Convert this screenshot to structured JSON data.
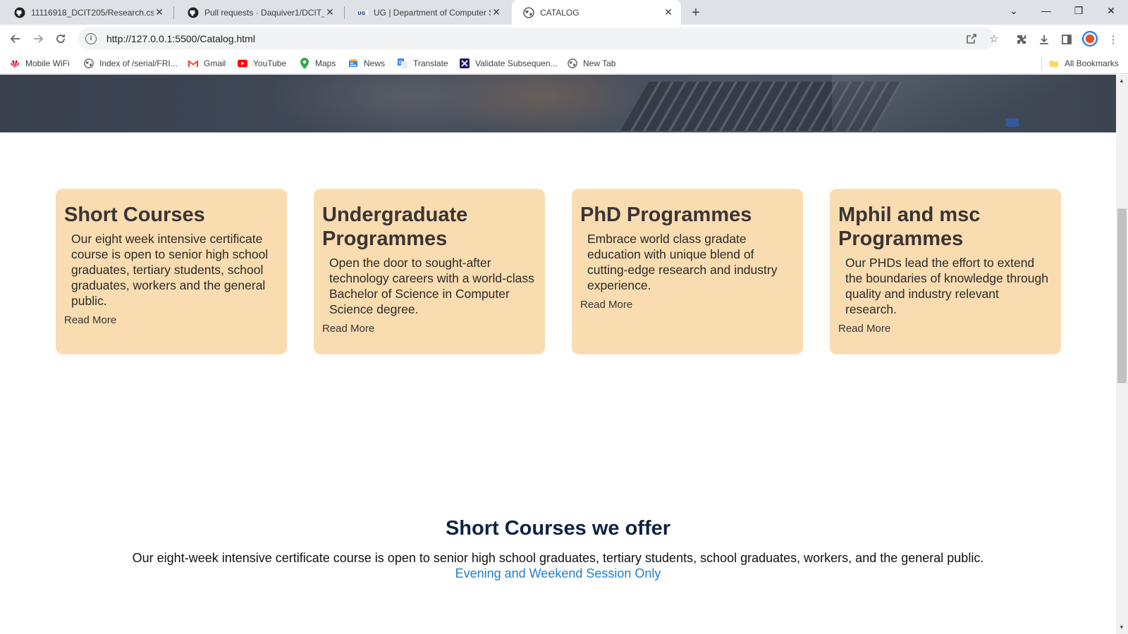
{
  "browser": {
    "tabs": [
      {
        "title": "11116918_DCIT205/Research.css",
        "icon": "github-icon"
      },
      {
        "title": "Pull requests · Daquiver1/DCIT_205",
        "icon": "github-icon"
      },
      {
        "title": "UG | Department of Computer Science",
        "icon": "ug-icon"
      },
      {
        "title": "CATALOG",
        "icon": "globe-icon"
      }
    ],
    "address_url": "http://127.0.0.1:5500/Catalog.html",
    "bookmarks": [
      {
        "label": "Mobile WiFi",
        "icon": "huawei-icon",
        "color": "#e4002b"
      },
      {
        "label": "Index of /serial/FRI...",
        "icon": "globe-icon",
        "color": "#5f6368"
      },
      {
        "label": "Gmail",
        "icon": "gmail-icon",
        "color": "#ea4335"
      },
      {
        "label": "YouTube",
        "icon": "youtube-icon",
        "color": "#ff0000"
      },
      {
        "label": "Maps",
        "icon": "maps-icon",
        "color": "#34a853"
      },
      {
        "label": "News",
        "icon": "news-icon",
        "color": "#4285f4"
      },
      {
        "label": "Translate",
        "icon": "translate-icon",
        "color": "#4285f4"
      },
      {
        "label": "Validate Subsequen...",
        "icon": "x-logo-icon",
        "color": "#1a1a5e"
      },
      {
        "label": "New Tab",
        "icon": "globe-icon",
        "color": "#5f6368"
      }
    ],
    "all_bookmarks": "All Bookmarks"
  },
  "cards": [
    {
      "title": "Short Courses",
      "text": "Our eight week intensive certificate course is open to senior high school graduates, tertiary students, school graduates, workers and the general public.",
      "link": "Read More"
    },
    {
      "title": "Undergraduate Programmes",
      "text": "Open the door to sought-after technology careers with a world-class Bachelor of Science in Computer Science degree.",
      "link": "Read More"
    },
    {
      "title": "PhD Programmes",
      "text": "Embrace world class gradate education with unique blend of cutting-edge research and industry experience.",
      "link": "Read More"
    },
    {
      "title": "Mphil and msc Programmes",
      "text": "Our PHDs lead the effort to extend the boundaries of knowledge through quality and industry relevant research.",
      "link": "Read More"
    }
  ],
  "offer": {
    "title": "Short Courses we offer",
    "description": "Our eight-week intensive certificate course is open to senior high school graduates, tertiary students, school graduates, workers, and the general public.",
    "session_link": "Evening and Weekend Session Only"
  },
  "colors": {
    "card_bg": "#fadcb1",
    "heading_dark": "#0f2444",
    "link_blue": "#1e7fd0"
  }
}
